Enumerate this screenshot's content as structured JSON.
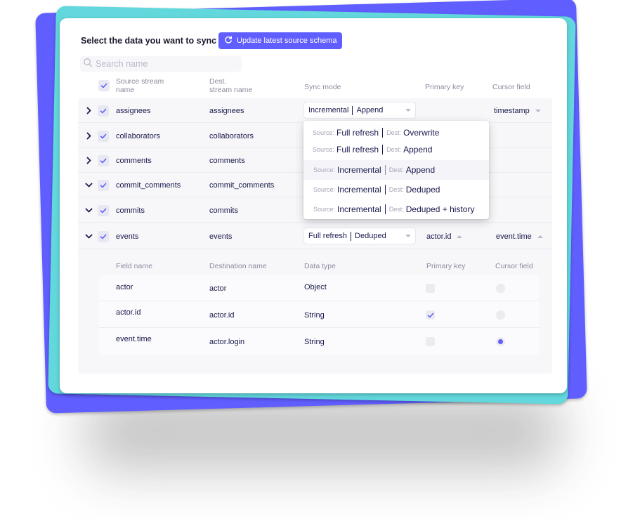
{
  "header": {
    "title": "Select the data you want to sync",
    "update_button": "Update latest source schema"
  },
  "search": {
    "placeholder": "Search name",
    "value": ""
  },
  "columns": {
    "source_stream_line1": "Source stream",
    "source_stream_line2": "name",
    "dest_stream_line1": "Dest.",
    "dest_stream_line2": "stream name",
    "sync_mode": "Sync mode",
    "primary_key": "Primary key",
    "cursor_field": "Cursor field"
  },
  "select_all_checked": true,
  "streams": [
    {
      "source": "assignees",
      "dest": "assignees",
      "expanded": false,
      "checked": true,
      "sync_src": "Incremental",
      "sync_dest": "Append",
      "primary_key": "",
      "cursor": "timestamp"
    },
    {
      "source": "collaborators",
      "dest": "collaborators",
      "expanded": false,
      "checked": true
    },
    {
      "source": "comments",
      "dest": "comments",
      "expanded": false,
      "checked": true
    },
    {
      "source": "commit_comments",
      "dest": "commit_comments",
      "expanded": true,
      "checked": true
    },
    {
      "source": "commits",
      "dest": "commits",
      "expanded": true,
      "checked": true
    },
    {
      "source": "events",
      "dest": "events",
      "expanded": true,
      "checked": true,
      "sync_src": "Full refresh",
      "sync_dest": "Deduped",
      "primary_key": "actor.id",
      "cursor": "event.time"
    }
  ],
  "fields": {
    "headers": {
      "field_name": "Field name",
      "destination_name": "Destination name",
      "data_type": "Data type",
      "primary_key": "Primary key",
      "cursor_field": "Cursor field"
    },
    "rows": [
      {
        "field": "actor",
        "dest": "actor",
        "type": "Object",
        "pk": false,
        "cursor": false
      },
      {
        "field": "actor.id",
        "dest": "actor.id",
        "type": "String",
        "pk": true,
        "cursor": false
      },
      {
        "field": "event.time",
        "dest": "actor.login",
        "type": "String",
        "pk": false,
        "cursor": true
      }
    ]
  },
  "sync_dropdown": {
    "source_label": "Source:",
    "dest_label": "Dest:",
    "options": [
      {
        "src": "Full refresh",
        "dest": "Overwrite",
        "highlighted": false
      },
      {
        "src": "Full refresh",
        "dest": "Append",
        "highlighted": false
      },
      {
        "src": "Incremental",
        "dest": "Append",
        "highlighted": true
      },
      {
        "src": "Incremental",
        "dest": "Deduped",
        "highlighted": false
      },
      {
        "src": "Incremental",
        "dest": "Deduped + history",
        "highlighted": false
      }
    ]
  },
  "colors": {
    "accent": "#615eff",
    "teal": "#62d8dc",
    "text": "#1a194d",
    "muted": "#8c8ba0"
  }
}
